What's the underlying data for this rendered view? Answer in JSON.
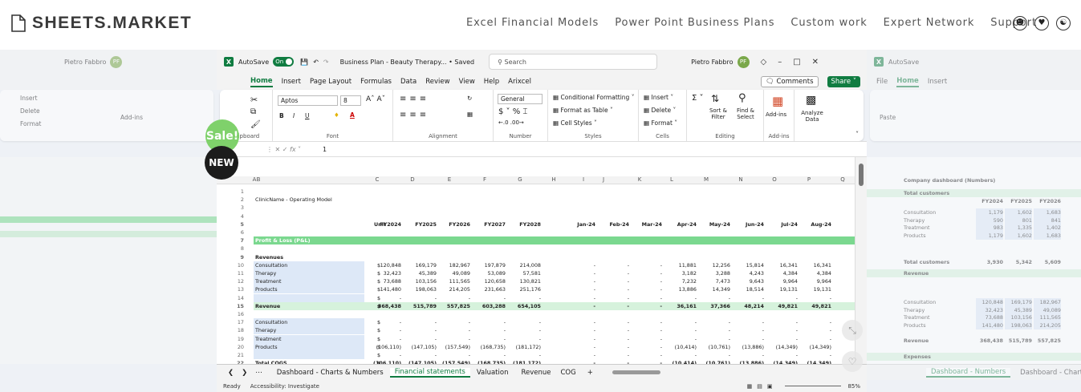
{
  "site": {
    "logo": "SHEETS.MARKET",
    "nav": [
      "Excel Financial Models",
      "Power Point Business Plans",
      "Custom work",
      "Expert Network",
      "Support"
    ]
  },
  "badges": {
    "sale": "Sale!",
    "new": "NEW"
  },
  "excel": {
    "autosave": "AutoSave",
    "toggle": "On",
    "doc": "Business Plan - Beauty Therapy... • Saved",
    "search": "Search",
    "user": "Pietro Fabbro",
    "initials": "PF",
    "menu": [
      "File",
      "Home",
      "Insert",
      "Page Layout",
      "Formulas",
      "Data",
      "Review",
      "View",
      "Help",
      "Arixcel"
    ],
    "comments": "Comments",
    "share": "Share",
    "ribbon": {
      "clipboard": "Clipboard",
      "paste": "Paste",
      "font_name": "Aptos",
      "font_size": "8",
      "font": "Font",
      "alignment": "Alignment",
      "num_format": "General",
      "number": "Number",
      "cond": "Conditional Formatting",
      "fmt_table": "Format as Table",
      "cell_styles": "Cell Styles",
      "styles": "Styles",
      "insert": "Insert",
      "delete": "Delete",
      "format": "Format",
      "cells": "Cells",
      "sort": "Sort & Filter",
      "find": "Find & Select",
      "editing": "Editing",
      "addins": "Add-ins",
      "analyze": "Analyze Data"
    },
    "namebox": "A1",
    "fx": "fx",
    "formula": "1",
    "cols": [
      "A",
      "B",
      "C",
      "D",
      "E",
      "F",
      "G",
      "H",
      "I",
      "J",
      "K",
      "L",
      "M",
      "N",
      "O",
      "P",
      "Q"
    ],
    "sheets": [
      "Dashboard - Charts & Numbers",
      "Financial statements",
      "Valuation",
      "Revenue",
      "COG"
    ],
    "status": "Ready",
    "access": "Accessibility: Investigate",
    "zoom": "85%"
  },
  "rows": [
    {
      "n": "1",
      "c": []
    },
    {
      "n": "2",
      "b": "ClinicName - Operating Model",
      "c": []
    },
    {
      "n": "3",
      "c": []
    },
    {
      "n": "4",
      "c": []
    },
    {
      "n": "5",
      "u": "Unit",
      "c": [
        "FY2024",
        "FY2025",
        "FY2026",
        "FY2027",
        "FY2028",
        "Jan-24",
        "Feb-24",
        "Mar-24",
        "Apr-24",
        "May-24",
        "Jun-24",
        "Jul-24",
        "Aug-24"
      ],
      "st": "bold"
    },
    {
      "n": "6",
      "c": []
    },
    {
      "n": "7",
      "b": "Profit & Loss (P&L)",
      "c": [],
      "st": "pl"
    },
    {
      "n": "8",
      "c": []
    },
    {
      "n": "9",
      "b": "Revenues",
      "c": [],
      "st": "bold"
    },
    {
      "n": "10",
      "b": "Consultation",
      "u": "$",
      "c": [
        "120,848",
        "169,179",
        "182,967",
        "197,879",
        "214,008",
        "-",
        "-",
        "-",
        "11,881",
        "12,256",
        "15,814",
        "16,341",
        "16,341"
      ],
      "st": "bl"
    },
    {
      "n": "11",
      "b": "Therapy",
      "u": "$",
      "c": [
        "32,423",
        "45,389",
        "49,089",
        "53,089",
        "57,581",
        "-",
        "-",
        "-",
        "3,182",
        "3,288",
        "4,243",
        "4,384",
        "4,384"
      ],
      "st": "bl"
    },
    {
      "n": "12",
      "b": "Treatment",
      "u": "$",
      "c": [
        "73,688",
        "103,156",
        "111,565",
        "120,658",
        "130,821",
        "-",
        "-",
        "-",
        "7,232",
        "7,473",
        "9,643",
        "9,964",
        "9,964"
      ],
      "st": "bl"
    },
    {
      "n": "13",
      "b": "Products",
      "u": "$",
      "c": [
        "141,480",
        "198,063",
        "214,205",
        "231,663",
        "251,176",
        "-",
        "-",
        "-",
        "13,886",
        "14,349",
        "18,514",
        "19,131",
        "19,131"
      ],
      "st": "bl"
    },
    {
      "n": "14",
      "u": "$",
      "c": [
        "-",
        "-",
        "-",
        "-",
        "-",
        "-",
        "-",
        "-",
        "-",
        "-",
        "-",
        "-",
        "-"
      ],
      "st": "bl"
    },
    {
      "n": "15",
      "b": "Revenue",
      "u": "$",
      "c": [
        "368,438",
        "515,789",
        "557,825",
        "603,288",
        "654,105",
        "-",
        "-",
        "-",
        "36,161",
        "37,366",
        "48,214",
        "49,821",
        "49,821"
      ],
      "st": "gr"
    },
    {
      "n": "16",
      "c": []
    },
    {
      "n": "17",
      "b": "Consultation",
      "u": "$",
      "c": [
        "-",
        "-",
        "-",
        "-",
        "-",
        "-",
        "-",
        "-",
        "-",
        "-",
        "-",
        "-",
        "-"
      ],
      "st": "bl"
    },
    {
      "n": "18",
      "b": "Therapy",
      "u": "$",
      "c": [
        "-",
        "-",
        "-",
        "-",
        "-",
        "-",
        "-",
        "-",
        "-",
        "-",
        "-",
        "-",
        "-"
      ],
      "st": "bl"
    },
    {
      "n": "19",
      "b": "Treatment",
      "u": "$",
      "c": [
        "-",
        "-",
        "-",
        "-",
        "-",
        "-",
        "-",
        "-",
        "-",
        "-",
        "-",
        "-",
        "-"
      ],
      "st": "bl"
    },
    {
      "n": "20",
      "b": "Products",
      "u": "$",
      "c": [
        "(106,110)",
        "(147,105)",
        "(157,549)",
        "(168,735)",
        "(181,172)",
        "-",
        "-",
        "-",
        "(10,414)",
        "(10,761)",
        "(13,886)",
        "(14,349)",
        "(14,349)"
      ],
      "st": "bl"
    },
    {
      "n": "21",
      "u": "$",
      "c": [
        "-",
        "-",
        "-",
        "-",
        "-",
        "-",
        "-",
        "-",
        "-",
        "-",
        "-",
        "-",
        "-"
      ],
      "st": "bl"
    },
    {
      "n": "22",
      "b": "Total COGS",
      "u": "$",
      "c": [
        "(106,110)",
        "(147,105)",
        "(157,549)",
        "(168,735)",
        "(181,172)",
        "-",
        "-",
        "-",
        "(10,414)",
        "(10,761)",
        "(13,886)",
        "(14,349)",
        "(14,349)"
      ],
      "st": "bold"
    }
  ],
  "right": {
    "title": "Company dashboard (Numbers)",
    "total": "Total customers",
    "fy": [
      "FY2024",
      "FY2025",
      "FY2026"
    ],
    "items": [
      [
        "Consultation",
        "1,179",
        "1,602",
        "1,683"
      ],
      [
        "Therapy",
        "590",
        "801",
        "841"
      ],
      [
        "Treatment",
        "983",
        "1,335",
        "1,402"
      ],
      [
        "Products",
        "1,179",
        "1,602",
        "1,683"
      ]
    ],
    "tot": [
      "3,930",
      "5,342",
      "5,609"
    ],
    "rev": "Revenue",
    "ritems": [
      [
        "Consultation",
        "120,848",
        "169,179",
        "182,967"
      ],
      [
        "Therapy",
        "32,423",
        "45,389",
        "49,089"
      ],
      [
        "Treatment",
        "73,688",
        "103,156",
        "111,565"
      ],
      [
        "Products",
        "141,480",
        "198,063",
        "214,205"
      ]
    ],
    "rtot": [
      "368,438",
      "515,789",
      "557,825"
    ],
    "exp": "Expenses",
    "tabs": [
      "Dashboard - Numbers",
      "Dashboard - Charts"
    ]
  }
}
